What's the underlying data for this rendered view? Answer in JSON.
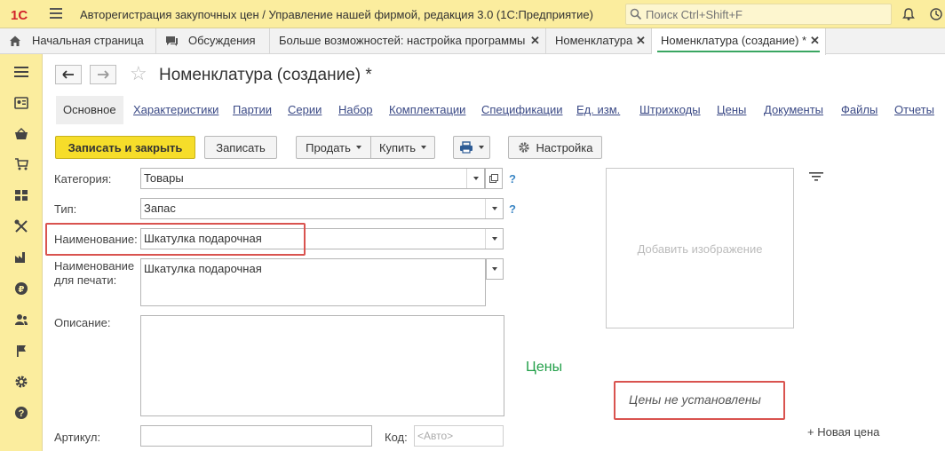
{
  "topbar": {
    "logo_text": "1С",
    "app_title": "Авторегистрация закупочных цен / Управление нашей фирмой, редакция 3.0  (1С:Предприятие)",
    "search_placeholder": "Поиск Ctrl+Shift+F"
  },
  "tabs": [
    {
      "label": "Начальная страница"
    },
    {
      "label": "Обсуждения"
    },
    {
      "label": "Больше возможностей: настройка программы"
    },
    {
      "label": "Номенклатура"
    },
    {
      "label": "Номенклатура (создание) *"
    }
  ],
  "tab_close": "✕",
  "sidebar": {
    "items": [
      "menu-icon",
      "contacts-icon",
      "basket-icon",
      "cart-icon",
      "grid-icon",
      "tools-icon",
      "factory-icon",
      "money-icon",
      "people-icon",
      "flag-icon",
      "gear-icon",
      "help-icon"
    ]
  },
  "form": {
    "title": "Номенклатура (создание) *",
    "subtabs": [
      "Основное",
      "Характеристики",
      "Партии",
      "Серии",
      "Набор",
      "Комплектации",
      "Спецификации",
      "Ед. изм.",
      "Штрихкоды",
      "Цены",
      "Документы",
      "Файлы",
      "Отчеты"
    ],
    "buttons": {
      "save_close": "Записать и закрыть",
      "save": "Записать",
      "sell": "Продать",
      "buy": "Купить",
      "settings": "Настройка"
    },
    "fields": {
      "category_label": "Категория:",
      "category_value": "Товары",
      "type_label": "Тип:",
      "type_value": "Запас",
      "name_label": "Наименование:",
      "name_value": "Шкатулка подарочная",
      "print_name_label_1": "Наименование",
      "print_name_label_2": "для печати:",
      "print_name_value": "Шкатулка подарочная",
      "description_label": "Описание:",
      "description_value": "",
      "article_label": "Артикул:",
      "article_value": "",
      "code_label": "Код:",
      "code_placeholder": "<Авто>"
    },
    "help_mark": "?",
    "image_placeholder": "Добавить изображение",
    "prices_title": "Цены",
    "prices_empty": "Цены не установлены",
    "new_price": "+ Новая цена"
  }
}
